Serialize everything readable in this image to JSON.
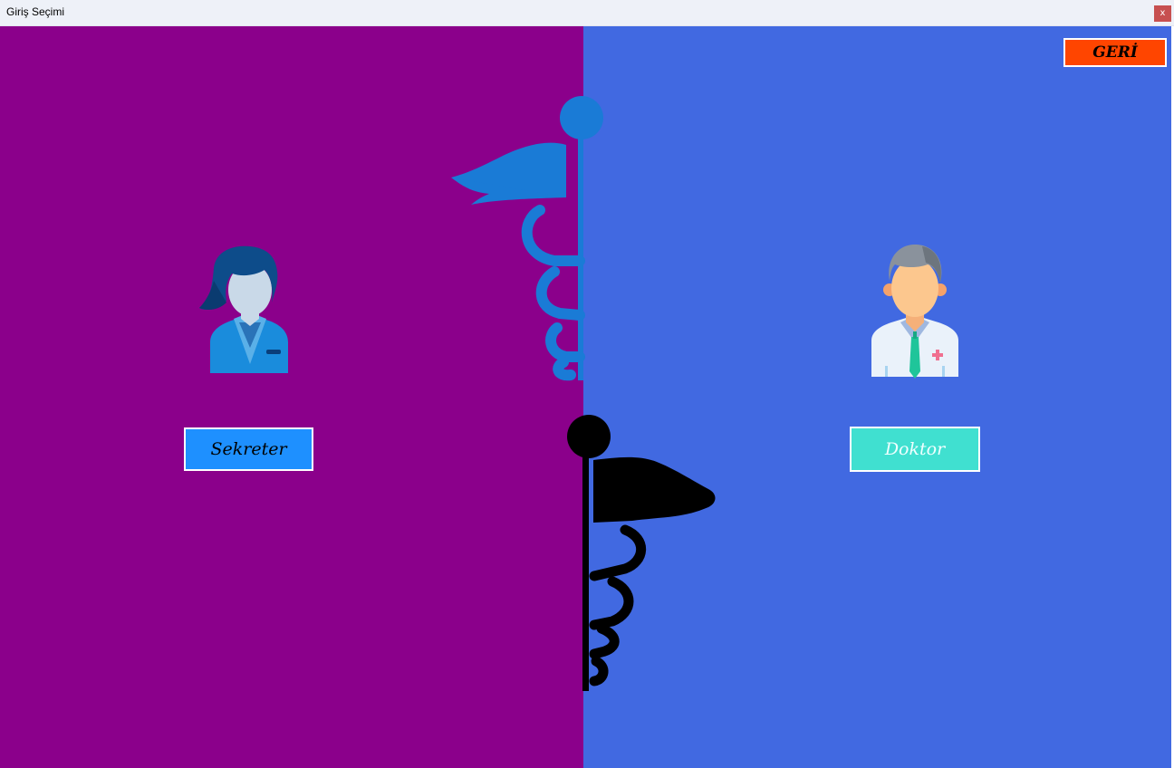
{
  "window": {
    "title": "Giriş Seçimi",
    "close_label": "x"
  },
  "buttons": {
    "sekreter": "Sekreter",
    "doktor": "Doktor",
    "geri": "GERİ"
  },
  "colors": {
    "left_panel": "#8b008b",
    "right_panel": "#4169e1",
    "sekreter_button": "#1e90ff",
    "doktor_button": "#40e0d0",
    "geri_button": "#ff4500"
  },
  "icons": [
    "secretary-icon",
    "doctor-icon",
    "caduceus-blue-icon",
    "caduceus-black-icon"
  ]
}
